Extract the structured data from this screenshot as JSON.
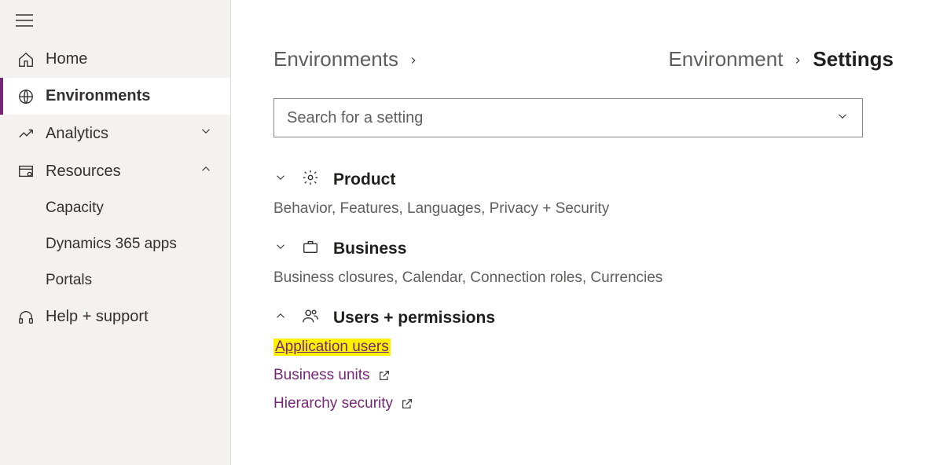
{
  "sidebar": {
    "items": {
      "home": "Home",
      "environments": "Environments",
      "analytics": "Analytics",
      "resources": "Resources",
      "capacity": "Capacity",
      "dynamics": "Dynamics 365 apps",
      "portals": "Portals",
      "help": "Help + support"
    }
  },
  "breadcrumb": {
    "left_root": "Environments",
    "right_env": "Environment",
    "right_current": "Settings"
  },
  "search": {
    "placeholder": "Search for a setting"
  },
  "sections": {
    "product": {
      "title": "Product",
      "desc": "Behavior, Features, Languages, Privacy + Security"
    },
    "business": {
      "title": "Business",
      "desc": "Business closures, Calendar, Connection roles, Currencies"
    },
    "users": {
      "title": "Users + permissions",
      "links": {
        "app_users": "Application users",
        "bu": "Business units",
        "hierarchy": "Hierarchy security"
      }
    }
  }
}
